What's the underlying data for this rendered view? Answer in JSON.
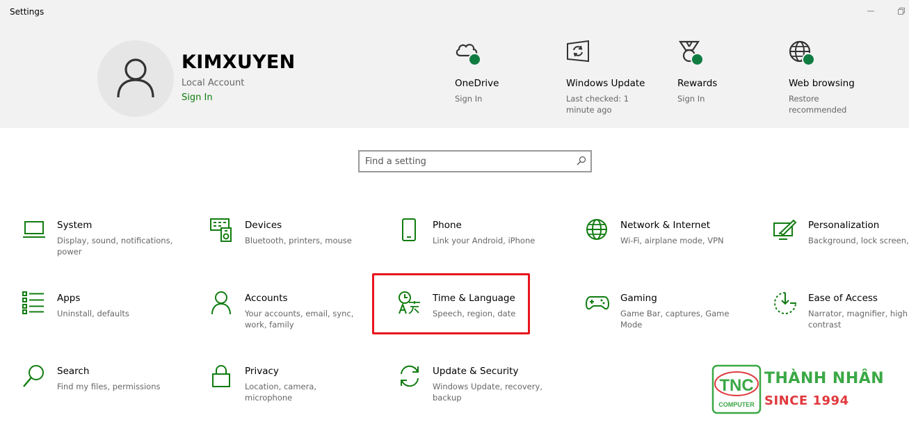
{
  "window": {
    "title": "Settings"
  },
  "account": {
    "name": "KIMXUYEN",
    "type": "Local Account",
    "signin": "Sign In"
  },
  "tiles": [
    {
      "name": "OneDrive",
      "sub": "Sign In"
    },
    {
      "name": "Windows Update",
      "sub": "Last checked: 1 minute ago"
    },
    {
      "name": "Rewards",
      "sub": "Sign In"
    },
    {
      "name": "Web browsing",
      "sub": "Restore recommended"
    }
  ],
  "search": {
    "placeholder": "Find a setting"
  },
  "categories": [
    {
      "name": "System",
      "desc": "Display, sound, notifications, power"
    },
    {
      "name": "Devices",
      "desc": "Bluetooth, printers, mouse"
    },
    {
      "name": "Phone",
      "desc": "Link your Android, iPhone"
    },
    {
      "name": "Network & Internet",
      "desc": "Wi-Fi, airplane mode, VPN"
    },
    {
      "name": "Personalization",
      "desc": "Background, lock screen, co"
    },
    {
      "name": "Apps",
      "desc": "Uninstall, defaults"
    },
    {
      "name": "Accounts",
      "desc": "Your accounts, email, sync, work, family"
    },
    {
      "name": "Time & Language",
      "desc": "Speech, region, date"
    },
    {
      "name": "Gaming",
      "desc": "Game Bar, captures, Game Mode"
    },
    {
      "name": "Ease of Access",
      "desc": "Narrator, magnifier, high contrast"
    },
    {
      "name": "Search",
      "desc": "Find my files, permissions"
    },
    {
      "name": "Privacy",
      "desc": "Location, camera, microphone"
    },
    {
      "name": "Update & Security",
      "desc": "Windows Update, recovery, backup"
    }
  ],
  "watermark": {
    "mark_text": "TNC",
    "mark_sub": "COMPUTER",
    "line1": "THÀNH NHÂN",
    "line2": "SINCE 1994"
  },
  "colors": {
    "accent": "#107c10",
    "status_dot": "#107c41",
    "highlight": "#e8141c"
  }
}
